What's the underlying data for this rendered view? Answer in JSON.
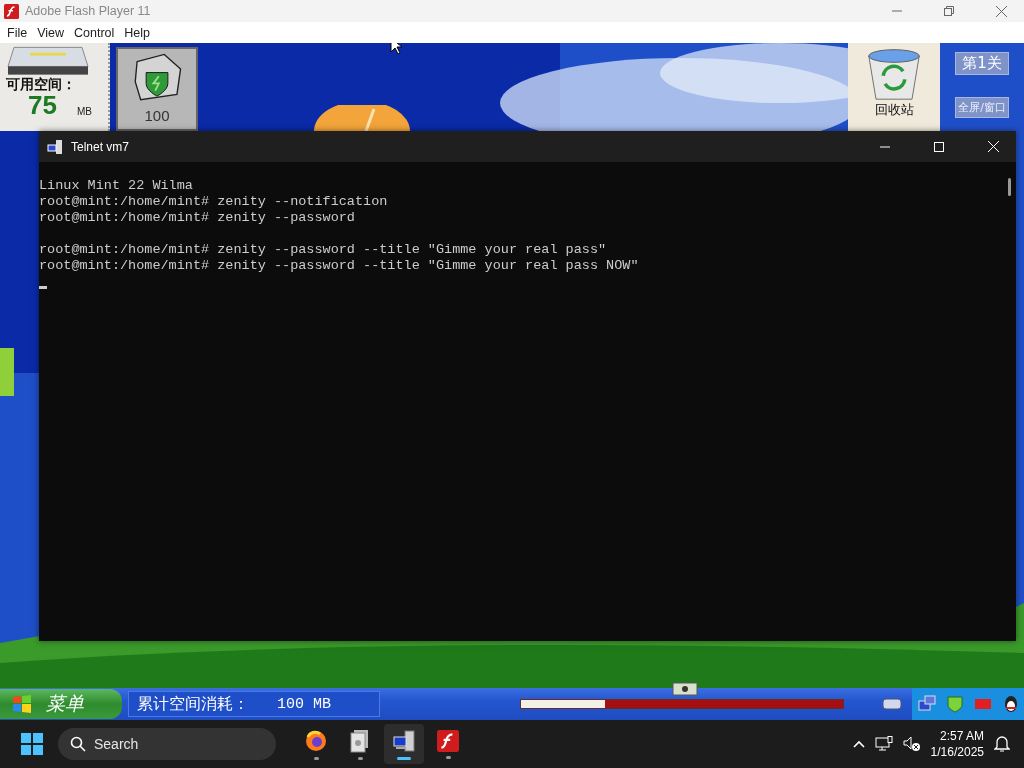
{
  "player_window": {
    "title": "Adobe Flash Player 11",
    "menu": [
      "File",
      "View",
      "Control",
      "Help"
    ]
  },
  "game": {
    "disk_panel": {
      "label": "可用空间：",
      "value": "75",
      "unit": "MB"
    },
    "shield_tile": {
      "value": "100"
    },
    "recycle_bin": {
      "label": "回收站"
    },
    "level_button": "第1关",
    "fullscreen_button": "全屏/窗口",
    "game_taskbar": {
      "start_label": "菜单",
      "usage_label": "累计空间消耗：",
      "usage_value": "100 MB",
      "progress": {
        "level": 0.26
      }
    }
  },
  "telnet_window": {
    "title": "Telnet vm7",
    "blocks": [
      {
        "lines": [
          "Linux Mint 22 Wilma",
          "root@mint:/home/mint# zenity --notification",
          "root@mint:/home/mint# zenity --password"
        ]
      },
      {
        "lines": [
          "root@mint:/home/mint# zenity --password --title \"Gimme your real pass\"",
          "root@mint:/home/mint# zenity --password --title \"Gimme your real pass NOW\""
        ]
      }
    ]
  },
  "taskbar": {
    "search": {
      "placeholder": "Search"
    },
    "apps": [
      {
        "kind": "browser",
        "selected": false
      },
      {
        "kind": "files",
        "selected": false
      },
      {
        "kind": "telnet",
        "selected": true
      },
      {
        "kind": "flash",
        "selected": false
      }
    ],
    "time": "2:57 AM",
    "date": "1/16/2025"
  }
}
